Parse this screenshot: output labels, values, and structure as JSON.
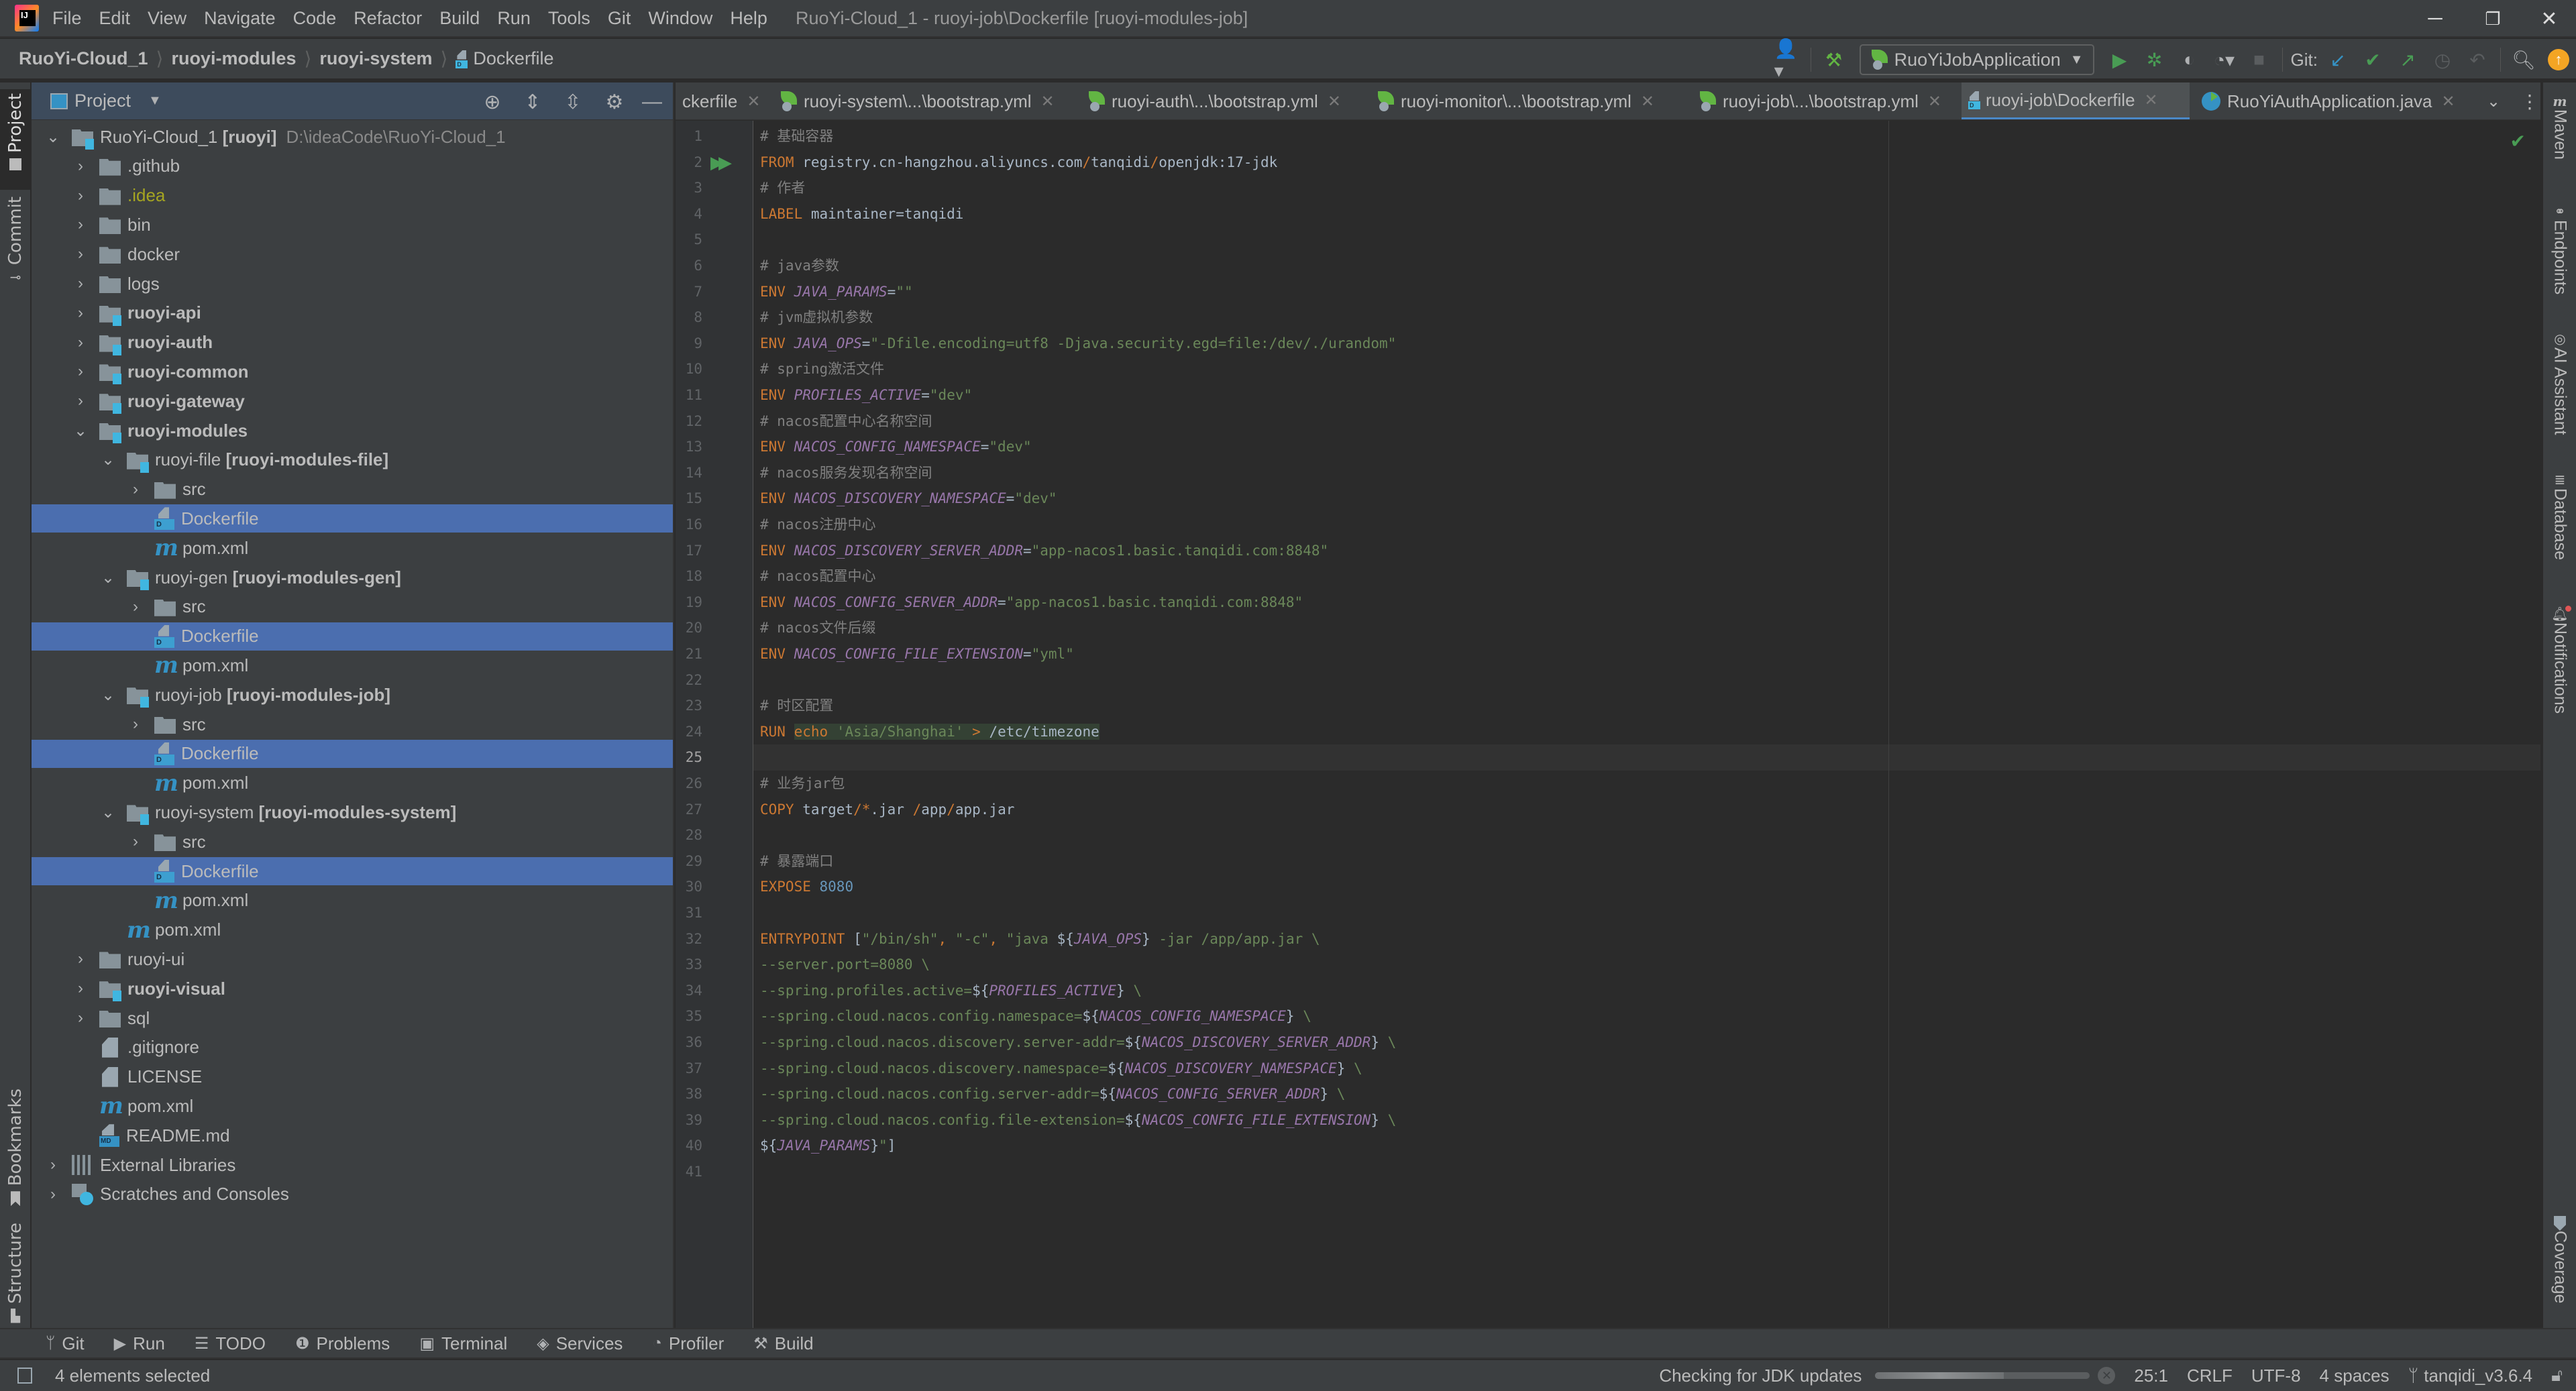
{
  "titlebar": {
    "menu": [
      "File",
      "Edit",
      "View",
      "Navigate",
      "Code",
      "Refactor",
      "Build",
      "Run",
      "Tools",
      "Git",
      "Window",
      "Help"
    ],
    "window_title": "RuoYi-Cloud_1 - ruoyi-job\\Dockerfile [ruoyi-modules-job]",
    "controls": {
      "minimize": "─",
      "restore": "❐",
      "close": "✕"
    }
  },
  "navbar": {
    "breadcrumbs": [
      "RuoYi-Cloud_1",
      "ruoyi-modules",
      "ruoyi-system",
      "Dockerfile"
    ],
    "run_config": "RuoYiJobApplication",
    "git_label": "Git:",
    "icons": [
      "user-icon",
      "build-hammer-icon",
      "run-icon",
      "debug-icon",
      "coverage-run-icon",
      "profiler-run-icon",
      "stop-icon",
      "git-update-icon",
      "git-commit-icon",
      "git-push-icon",
      "git-history-icon",
      "git-rollback-icon",
      "search-icon",
      "update-available-icon"
    ]
  },
  "left_stripe": {
    "top": [
      "Project",
      "Commit"
    ],
    "bottom": [
      "Bookmarks",
      "Structure"
    ]
  },
  "project_panel": {
    "title": "Project",
    "tree": [
      {
        "depth": 0,
        "expanded": true,
        "icon": "module-folder",
        "parts": [
          {
            "t": "RuoYi-Cloud_1 "
          },
          {
            "t": "[ruoyi]",
            "b": true
          },
          {
            "t": "D:\\ideaCode\\RuoYi-Cloud_1",
            "dim": true
          }
        ]
      },
      {
        "depth": 1,
        "expanded": false,
        "icon": "folder",
        "parts": [
          {
            "t": ".github"
          }
        ]
      },
      {
        "depth": 1,
        "expanded": false,
        "icon": "folder",
        "parts": [
          {
            "t": ".idea",
            "idea": true
          }
        ]
      },
      {
        "depth": 1,
        "expanded": false,
        "icon": "folder",
        "parts": [
          {
            "t": "bin"
          }
        ]
      },
      {
        "depth": 1,
        "expanded": false,
        "icon": "folder",
        "parts": [
          {
            "t": "docker"
          }
        ]
      },
      {
        "depth": 1,
        "expanded": false,
        "icon": "folder",
        "parts": [
          {
            "t": "logs"
          }
        ]
      },
      {
        "depth": 1,
        "expanded": false,
        "icon": "module-folder",
        "parts": [
          {
            "t": "ruoyi-api",
            "b": true
          }
        ]
      },
      {
        "depth": 1,
        "expanded": false,
        "icon": "module-folder",
        "parts": [
          {
            "t": "ruoyi-auth",
            "b": true
          }
        ]
      },
      {
        "depth": 1,
        "expanded": false,
        "icon": "module-folder",
        "parts": [
          {
            "t": "ruoyi-common",
            "b": true
          }
        ]
      },
      {
        "depth": 1,
        "expanded": false,
        "icon": "module-folder",
        "parts": [
          {
            "t": "ruoyi-gateway",
            "b": true
          }
        ]
      },
      {
        "depth": 1,
        "expanded": true,
        "icon": "module-folder",
        "parts": [
          {
            "t": "ruoyi-modules",
            "b": true
          }
        ]
      },
      {
        "depth": 2,
        "expanded": true,
        "icon": "module-folder",
        "parts": [
          {
            "t": "ruoyi-file "
          },
          {
            "t": "[ruoyi-modules-file]",
            "b": true
          }
        ]
      },
      {
        "depth": 3,
        "expanded": false,
        "icon": "folder",
        "parts": [
          {
            "t": "src"
          }
        ]
      },
      {
        "depth": 3,
        "icon": "docker",
        "selected": true,
        "parts": [
          {
            "t": "Dockerfile"
          }
        ]
      },
      {
        "depth": 3,
        "icon": "maven",
        "parts": [
          {
            "t": "pom.xml"
          }
        ]
      },
      {
        "depth": 2,
        "expanded": true,
        "icon": "module-folder",
        "parts": [
          {
            "t": "ruoyi-gen "
          },
          {
            "t": "[ruoyi-modules-gen]",
            "b": true
          }
        ]
      },
      {
        "depth": 3,
        "expanded": false,
        "icon": "folder",
        "parts": [
          {
            "t": "src"
          }
        ]
      },
      {
        "depth": 3,
        "icon": "docker",
        "selected": true,
        "parts": [
          {
            "t": "Dockerfile"
          }
        ]
      },
      {
        "depth": 3,
        "icon": "maven",
        "parts": [
          {
            "t": "pom.xml"
          }
        ]
      },
      {
        "depth": 2,
        "expanded": true,
        "icon": "module-folder",
        "parts": [
          {
            "t": "ruoyi-job "
          },
          {
            "t": "[ruoyi-modules-job]",
            "b": true
          }
        ]
      },
      {
        "depth": 3,
        "expanded": false,
        "icon": "folder",
        "parts": [
          {
            "t": "src"
          }
        ]
      },
      {
        "depth": 3,
        "icon": "docker",
        "selected": true,
        "parts": [
          {
            "t": "Dockerfile"
          }
        ]
      },
      {
        "depth": 3,
        "icon": "maven",
        "parts": [
          {
            "t": "pom.xml"
          }
        ]
      },
      {
        "depth": 2,
        "expanded": true,
        "icon": "module-folder",
        "parts": [
          {
            "t": "ruoyi-system "
          },
          {
            "t": "[ruoyi-modules-system]",
            "b": true
          }
        ]
      },
      {
        "depth": 3,
        "expanded": false,
        "icon": "folder",
        "parts": [
          {
            "t": "src"
          }
        ]
      },
      {
        "depth": 3,
        "icon": "docker",
        "selected": true,
        "parts": [
          {
            "t": "Dockerfile"
          }
        ]
      },
      {
        "depth": 3,
        "icon": "maven",
        "parts": [
          {
            "t": "pom.xml"
          }
        ]
      },
      {
        "depth": 2,
        "icon": "maven",
        "parts": [
          {
            "t": "pom.xml"
          }
        ]
      },
      {
        "depth": 1,
        "expanded": false,
        "icon": "folder",
        "parts": [
          {
            "t": "ruoyi-ui"
          }
        ]
      },
      {
        "depth": 1,
        "expanded": false,
        "icon": "module-folder",
        "parts": [
          {
            "t": "ruoyi-visual",
            "b": true
          }
        ]
      },
      {
        "depth": 1,
        "expanded": false,
        "icon": "folder",
        "parts": [
          {
            "t": "sql"
          }
        ]
      },
      {
        "depth": 1,
        "icon": "gitignore",
        "parts": [
          {
            "t": ".gitignore"
          }
        ]
      },
      {
        "depth": 1,
        "icon": "text",
        "parts": [
          {
            "t": "LICENSE"
          }
        ]
      },
      {
        "depth": 1,
        "icon": "maven",
        "parts": [
          {
            "t": "pom.xml"
          }
        ]
      },
      {
        "depth": 1,
        "icon": "markdown",
        "parts": [
          {
            "t": "README.md"
          }
        ]
      },
      {
        "depth": 0,
        "expanded": false,
        "icon": "libraries",
        "parts": [
          {
            "t": "External Libraries"
          }
        ]
      },
      {
        "depth": 0,
        "expanded": false,
        "icon": "scratches",
        "parts": [
          {
            "t": "Scratches and Consoles"
          }
        ]
      }
    ]
  },
  "editor_tabs": [
    {
      "label": "ckerfile",
      "icon": "none"
    },
    {
      "label": "ruoyi-system\\...\\bootstrap.yml",
      "icon": "spring"
    },
    {
      "label": "ruoyi-auth\\...\\bootstrap.yml",
      "icon": "spring"
    },
    {
      "label": "ruoyi-monitor\\...\\bootstrap.yml",
      "icon": "spring"
    },
    {
      "label": "ruoyi-job\\...\\bootstrap.yml",
      "icon": "spring"
    },
    {
      "label": "ruoyi-job\\Dockerfile",
      "icon": "docker",
      "active": true
    },
    {
      "label": "RuoYiAuthApplication.java",
      "icon": "java"
    }
  ],
  "editor": {
    "current_line": 25,
    "lines": [
      [
        [
          "c",
          "# 基础容器"
        ]
      ],
      [
        [
          "k",
          "FROM"
        ],
        [
          "p",
          " registry.cn-hangzhou.aliyuncs.com"
        ],
        [
          "k",
          "/"
        ],
        [
          "p",
          "tanqidi"
        ],
        [
          "k",
          "/"
        ],
        [
          "p",
          "openjdk:17-jdk"
        ]
      ],
      [
        [
          "c",
          "# 作者"
        ]
      ],
      [
        [
          "k",
          "LABEL"
        ],
        [
          "p",
          " maintainer=tanqidi"
        ]
      ],
      [],
      [
        [
          "c",
          "# java参数"
        ]
      ],
      [
        [
          "k",
          "ENV"
        ],
        [
          "p",
          " "
        ],
        [
          "v",
          "JAVA_PARAMS"
        ],
        [
          "p",
          "="
        ],
        [
          "s",
          "\"\""
        ]
      ],
      [
        [
          "c",
          "# jvm虚拟机参数"
        ]
      ],
      [
        [
          "k",
          "ENV"
        ],
        [
          "p",
          " "
        ],
        [
          "v",
          "JAVA_OPS"
        ],
        [
          "p",
          "="
        ],
        [
          "s",
          "\"-Dfile.encoding=utf8 -Djava.security.egd=file:/dev/./urandom\""
        ]
      ],
      [
        [
          "c",
          "# spring激活文件"
        ]
      ],
      [
        [
          "k",
          "ENV"
        ],
        [
          "p",
          " "
        ],
        [
          "v",
          "PROFILES_ACTIVE"
        ],
        [
          "p",
          "="
        ],
        [
          "s",
          "\"dev\""
        ]
      ],
      [
        [
          "c",
          "# nacos配置中心名称空间"
        ]
      ],
      [
        [
          "k",
          "ENV"
        ],
        [
          "p",
          " "
        ],
        [
          "v",
          "NACOS_CONFIG_NAMESPACE"
        ],
        [
          "p",
          "="
        ],
        [
          "s",
          "\"dev\""
        ]
      ],
      [
        [
          "c",
          "# nacos服务发现名称空间"
        ]
      ],
      [
        [
          "k",
          "ENV"
        ],
        [
          "p",
          " "
        ],
        [
          "v",
          "NACOS_DISCOVERY_NAMESPACE"
        ],
        [
          "p",
          "="
        ],
        [
          "s",
          "\"dev\""
        ]
      ],
      [
        [
          "c",
          "# nacos注册中心"
        ]
      ],
      [
        [
          "k",
          "ENV"
        ],
        [
          "p",
          " "
        ],
        [
          "v",
          "NACOS_DISCOVERY_SERVER_ADDR"
        ],
        [
          "p",
          "="
        ],
        [
          "s",
          "\"app-nacos1.basic.tanqidi.com:8848\""
        ]
      ],
      [
        [
          "c",
          "# nacos配置中心"
        ]
      ],
      [
        [
          "k",
          "ENV"
        ],
        [
          "p",
          " "
        ],
        [
          "v",
          "NACOS_CONFIG_SERVER_ADDR"
        ],
        [
          "p",
          "="
        ],
        [
          "s",
          "\"app-nacos1.basic.tanqidi.com:8848\""
        ]
      ],
      [
        [
          "c",
          "# nacos文件后缀"
        ]
      ],
      [
        [
          "k",
          "ENV"
        ],
        [
          "p",
          " "
        ],
        [
          "v",
          "NACOS_CONFIG_FILE_EXTENSION"
        ],
        [
          "p",
          "="
        ],
        [
          "s",
          "\"yml\""
        ]
      ],
      [],
      [
        [
          "c",
          "# 时区配置"
        ]
      ],
      [
        [
          "k",
          "RUN"
        ],
        [
          "p",
          " "
        ],
        [
          "hk",
          "echo"
        ],
        [
          "hp",
          " "
        ],
        [
          "hs",
          "'Asia/Shanghai'"
        ],
        [
          "hp",
          " "
        ],
        [
          "hk",
          ">"
        ],
        [
          "hp",
          " /etc/timezone"
        ]
      ],
      [],
      [
        [
          "c",
          "# 业务jar包"
        ]
      ],
      [
        [
          "k",
          "COPY"
        ],
        [
          "p",
          " target"
        ],
        [
          "k",
          "/*"
        ],
        [
          "p",
          ".jar "
        ],
        [
          "k",
          "/"
        ],
        [
          "p",
          "app"
        ],
        [
          "k",
          "/"
        ],
        [
          "p",
          "app.jar"
        ]
      ],
      [],
      [
        [
          "c",
          "# 暴露端口"
        ]
      ],
      [
        [
          "k",
          "EXPOSE"
        ],
        [
          "p",
          " "
        ],
        [
          "n",
          "8080"
        ]
      ],
      [],
      [
        [
          "k",
          "ENTRYPOINT"
        ],
        [
          "p",
          " ["
        ],
        [
          "s",
          "\"/bin/sh\""
        ],
        [
          "k",
          ","
        ],
        [
          "p",
          " "
        ],
        [
          "s",
          "\"-c\""
        ],
        [
          "k",
          ","
        ],
        [
          "p",
          " "
        ],
        [
          "s",
          "\"java "
        ],
        [
          "p",
          "${"
        ],
        [
          "v",
          "JAVA_OPS"
        ],
        [
          "p",
          "}"
        ],
        [
          "s",
          " -jar /app/app.jar \\"
        ]
      ],
      [
        [
          "s",
          "--server.port=8080 \\"
        ]
      ],
      [
        [
          "s",
          "--spring.profiles.active="
        ],
        [
          "p",
          "${"
        ],
        [
          "v",
          "PROFILES_ACTIVE"
        ],
        [
          "p",
          "}"
        ],
        [
          "s",
          " \\"
        ]
      ],
      [
        [
          "s",
          "--spring.cloud.nacos.config.namespace="
        ],
        [
          "p",
          "${"
        ],
        [
          "v",
          "NACOS_CONFIG_NAMESPACE"
        ],
        [
          "p",
          "}"
        ],
        [
          "s",
          " \\"
        ]
      ],
      [
        [
          "s",
          "--spring.cloud.nacos.discovery.server-addr="
        ],
        [
          "p",
          "${"
        ],
        [
          "v",
          "NACOS_DISCOVERY_SERVER_ADDR"
        ],
        [
          "p",
          "}"
        ],
        [
          "s",
          " \\"
        ]
      ],
      [
        [
          "s",
          "--spring.cloud.nacos.discovery.namespace="
        ],
        [
          "p",
          "${"
        ],
        [
          "v",
          "NACOS_DISCOVERY_NAMESPACE"
        ],
        [
          "p",
          "}"
        ],
        [
          "s",
          " \\"
        ]
      ],
      [
        [
          "s",
          "--spring.cloud.nacos.config.server-addr="
        ],
        [
          "p",
          "${"
        ],
        [
          "v",
          "NACOS_CONFIG_SERVER_ADDR"
        ],
        [
          "p",
          "}"
        ],
        [
          "s",
          " \\"
        ]
      ],
      [
        [
          "s",
          "--spring.cloud.nacos.config.file-extension="
        ],
        [
          "p",
          "${"
        ],
        [
          "v",
          "NACOS_CONFIG_FILE_EXTENSION"
        ],
        [
          "p",
          "}"
        ],
        [
          "s",
          " \\"
        ]
      ],
      [
        [
          "p",
          "${"
        ],
        [
          "v",
          "JAVA_PARAMS"
        ],
        [
          "p",
          "}"
        ],
        [
          "s",
          "\""
        ],
        [
          "p",
          "]"
        ]
      ],
      []
    ]
  },
  "right_stripe": {
    "top": [
      "Maven",
      "Endpoints",
      "AI Assistant",
      "Database",
      "Notifications"
    ],
    "bottom": [
      "Coverage"
    ]
  },
  "bottom_tabs": [
    {
      "label": "Git",
      "icon": "git-branch-icon",
      "glyph": "ᛘ"
    },
    {
      "label": "Run",
      "icon": "run-icon",
      "glyph": "▶"
    },
    {
      "label": "TODO",
      "icon": "todo-icon",
      "glyph": "☰"
    },
    {
      "label": "Problems",
      "icon": "problems-icon",
      "glyph": "❶"
    },
    {
      "label": "Terminal",
      "icon": "terminal-icon",
      "glyph": "▣"
    },
    {
      "label": "Services",
      "icon": "services-icon",
      "glyph": "◈"
    },
    {
      "label": "Profiler",
      "icon": "profiler-icon",
      "glyph": "◔"
    },
    {
      "label": "Build",
      "icon": "build-hammer-icon",
      "glyph": "⚒"
    }
  ],
  "statusbar": {
    "selection": "4 elements selected",
    "task": "Checking for JDK updates",
    "task_progress": 0.6,
    "position": "25:1",
    "line_separator": "CRLF",
    "encoding": "UTF-8",
    "indent": "4 spaces",
    "branch": "tanqidi_v3.6.4"
  },
  "colors": {
    "accent": "#4a88c7",
    "selection": "#4b6eaf",
    "keyword": "#cc7832",
    "string": "#6a8759",
    "variable": "#9876aa",
    "comment": "#808080",
    "number": "#6897bb",
    "run_green": "#499c54"
  }
}
